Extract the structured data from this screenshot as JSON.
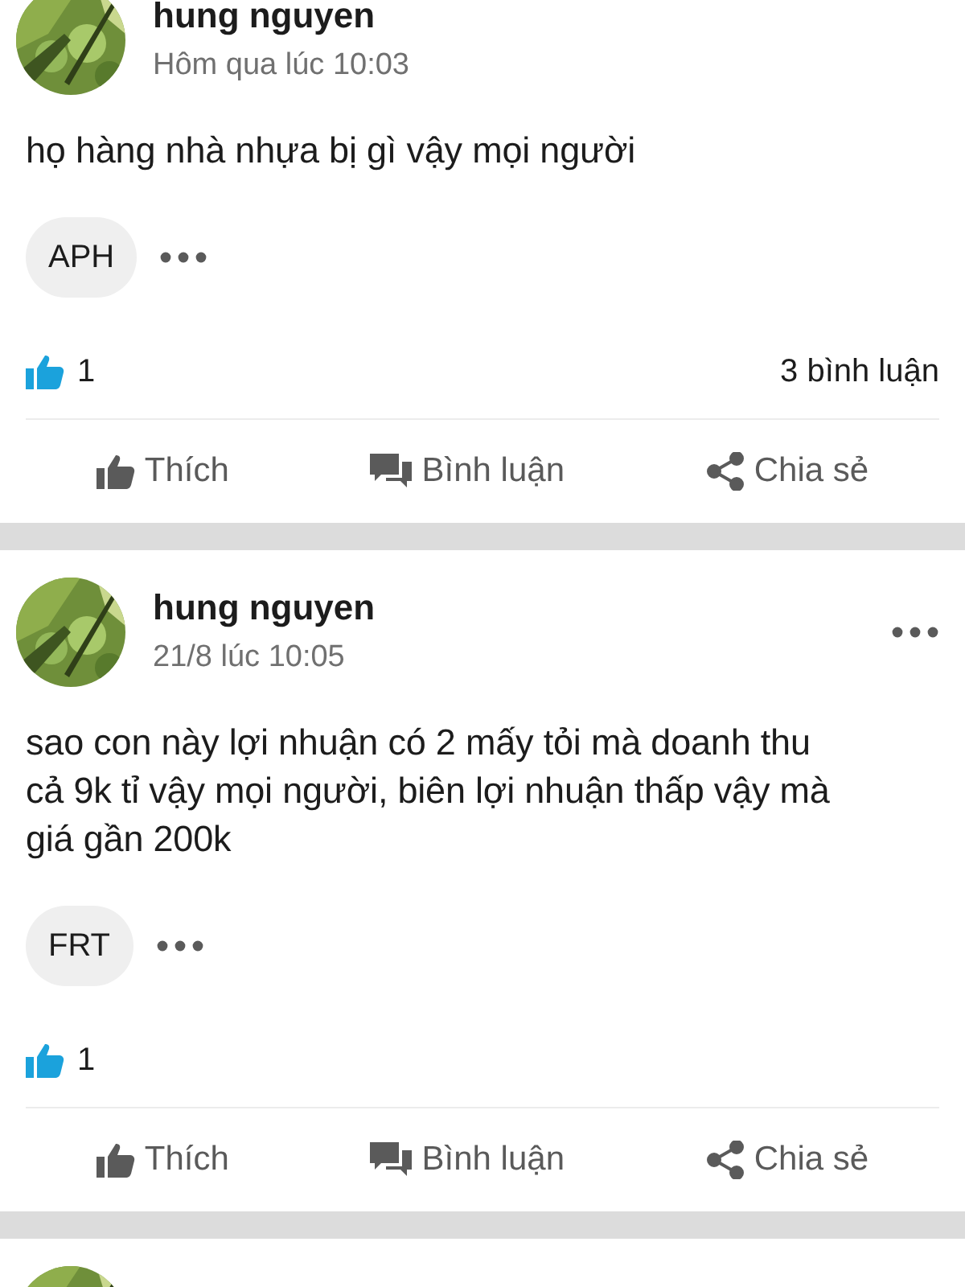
{
  "posts": [
    {
      "author": "hung nguyen",
      "time": "Hôm qua lúc 10:03",
      "has_menu": false,
      "text": "họ hàng nhà nhựa bị gì vậy mọi người",
      "tags": [
        "APH"
      ],
      "likes": "1",
      "comments": "3 bình luận",
      "actions": [
        {
          "kind": "like",
          "label": "Thích"
        },
        {
          "kind": "comment",
          "label": "Bình luận"
        },
        {
          "kind": "share",
          "label": "Chia sẻ"
        }
      ]
    },
    {
      "author": "hung nguyen",
      "time": "21/8 lúc 10:05",
      "has_menu": true,
      "text": "sao con này lợi nhuận có 2 mấy tỏi mà doanh thu cả 9k tỉ vậy mọi người, biên lợi nhuận thấp vậy mà giá gần 200k",
      "tags": [
        "FRT"
      ],
      "likes": "1",
      "actions": [
        {
          "kind": "like",
          "label": "Thích"
        },
        {
          "kind": "comment",
          "label": "Bình luận"
        },
        {
          "kind": "share",
          "label": "Chia sẻ"
        }
      ]
    }
  ]
}
